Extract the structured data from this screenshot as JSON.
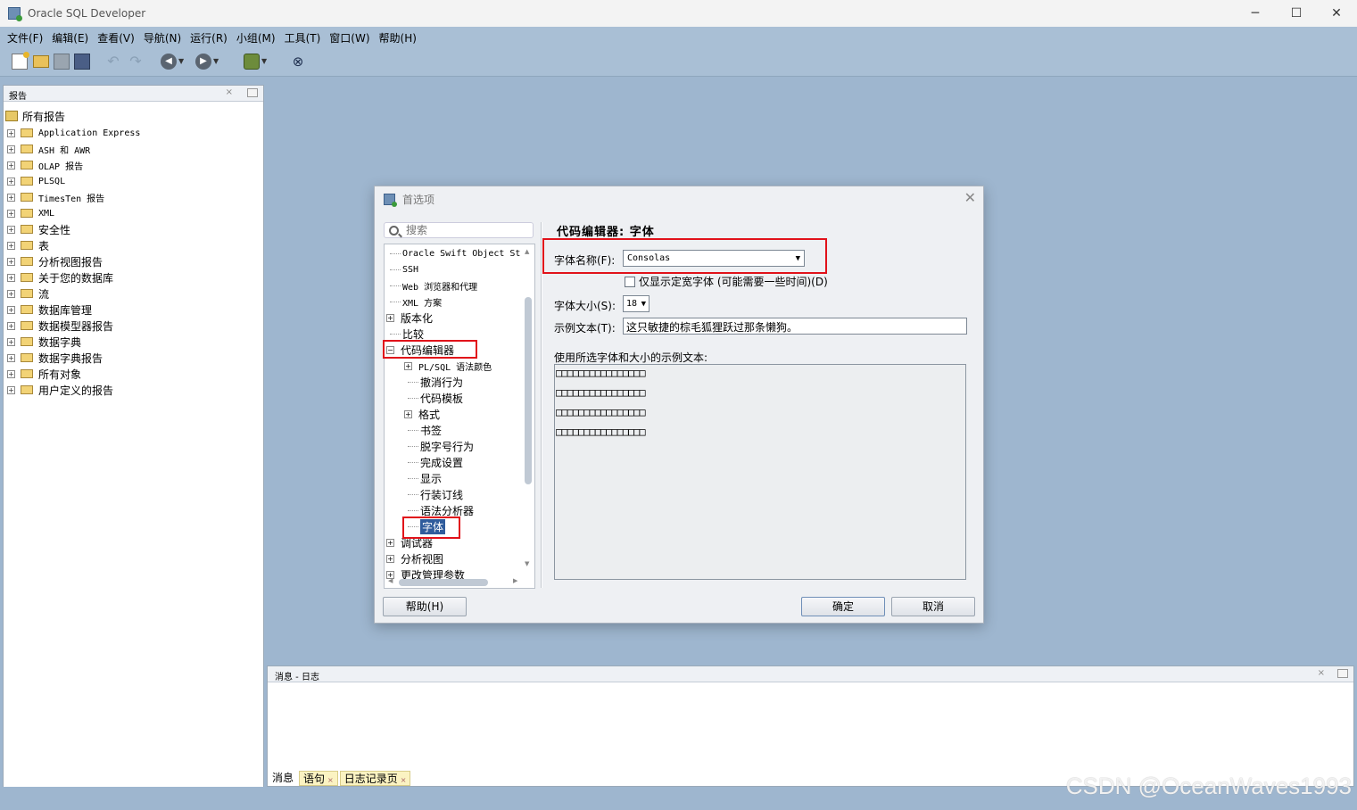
{
  "window": {
    "title": "Oracle SQL Developer",
    "minimize": "─",
    "maximize": "☐",
    "close": "✕"
  },
  "menu": [
    "文件(F)",
    "编辑(E)",
    "查看(V)",
    "导航(N)",
    "运行(R)",
    "小组(M)",
    "工具(T)",
    "窗口(W)",
    "帮助(H)"
  ],
  "toolbar": {
    "icons": [
      "new-file-icon",
      "open-folder-icon",
      "save-icon",
      "save-all-icon",
      "undo-icon",
      "redo-icon",
      "back-icon",
      "forward-icon",
      "database-connect-icon",
      "find-db-object-icon"
    ]
  },
  "reports": {
    "tab": "报告",
    "root": "所有报告",
    "items": [
      "Application Express",
      "ASH 和 AWR",
      "OLAP 报告",
      "PLSQL",
      "TimesTen 报告",
      "XML",
      "安全性",
      "表",
      "分析视图报告",
      "关于您的数据库",
      "流",
      "数据库管理",
      "数据模型器报告",
      "数据字典",
      "数据字典报告",
      "所有对象",
      "用户定义的报告"
    ]
  },
  "dialog": {
    "title": "首选项",
    "search_placeholder": "搜索",
    "tree": [
      {
        "label": "Oracle Swift Object St",
        "expander": ""
      },
      {
        "label": "SSH",
        "expander": ""
      },
      {
        "label": "Web 浏览器和代理",
        "expander": ""
      },
      {
        "label": "XML 方案",
        "expander": ""
      },
      {
        "label": "版本化",
        "expander": "+"
      },
      {
        "label": "比较",
        "expander": ""
      },
      {
        "label": "代码编辑器",
        "expander": "−"
      },
      {
        "label": "PL/SQL 语法颜色",
        "expander": "+"
      },
      {
        "label": "撤消行为",
        "expander": ""
      },
      {
        "label": "代码模板",
        "expander": ""
      },
      {
        "label": "格式",
        "expander": "+"
      },
      {
        "label": "书签",
        "expander": ""
      },
      {
        "label": "脱字号行为",
        "expander": ""
      },
      {
        "label": "完成设置",
        "expander": ""
      },
      {
        "label": "显示",
        "expander": ""
      },
      {
        "label": "行装订线",
        "expander": ""
      },
      {
        "label": "语法分析器",
        "expander": ""
      },
      {
        "label": "字体",
        "expander": ""
      },
      {
        "label": "调试器",
        "expander": "+"
      },
      {
        "label": "分析视图",
        "expander": "+"
      },
      {
        "label": "更改管理参数",
        "expander": "+"
      }
    ],
    "panel_title": "代码编辑器: 字体",
    "font_name_label": "字体名称(F):",
    "font_name_value": "Consolas",
    "only_mono_label": "仅显示定宽字体 (可能需要一些时间)(D)",
    "font_size_label": "字体大小(S):",
    "font_size_value": "18",
    "sample_label": "示例文本(T):",
    "sample_value": "这只敏捷的棕毛狐狸跃过那条懒狗。",
    "preview_label": "使用所选字体和大小的示例文本:",
    "preview_lines": [
      "□□□□□□□□□□□□□□□□",
      "□□□□□□□□□□□□□□□□",
      "□□□□□□□□□□□□□□□□",
      "□□□□□□□□□□□□□□□□"
    ],
    "help_button": "帮助(H)",
    "ok_button": "确定",
    "cancel_button": "取消"
  },
  "messages": {
    "tab": "消息 - 日志",
    "bottom_tabs": [
      "消息",
      "语句",
      "日志记录页"
    ]
  },
  "watermark": "CSDN @OceanWaves1993",
  "colors": {
    "highlight_box": "#e1121a",
    "selection": "#2f5c9c",
    "workspace": "#9eb6cf"
  }
}
